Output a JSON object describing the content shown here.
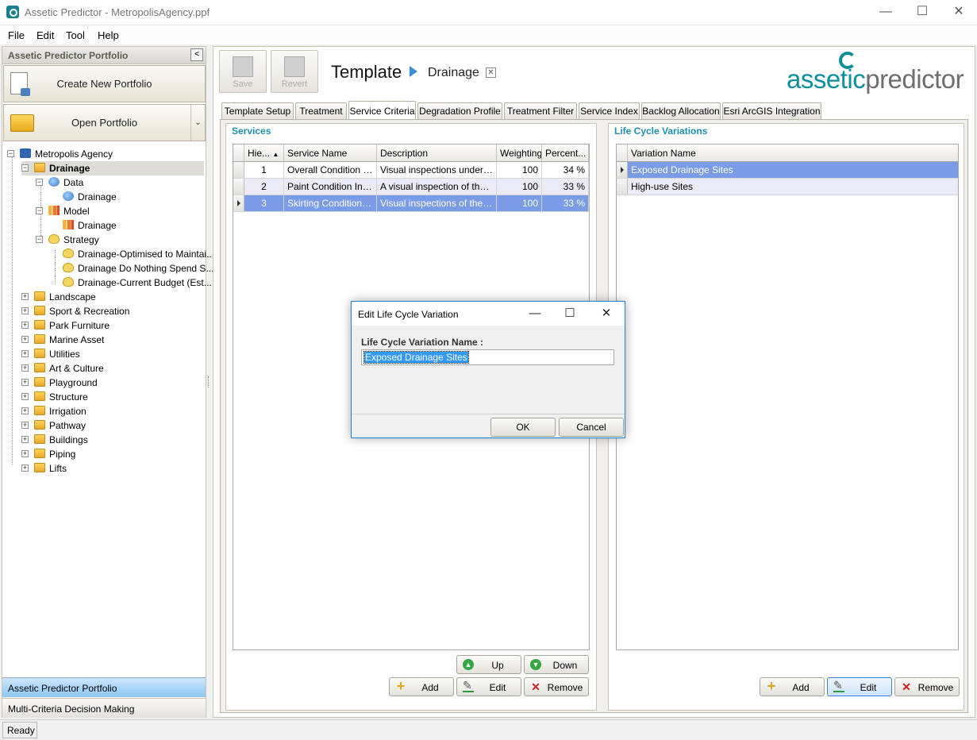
{
  "window": {
    "title": "Assetic Predictor - MetropolisAgency.ppf",
    "minimize": "—",
    "maximize": "☐",
    "close": "✕"
  },
  "menu": [
    "File",
    "Edit",
    "Tool",
    "Help"
  ],
  "left_panel": {
    "header": "Assetic Predictor Portfolio",
    "create_btn": "Create New Portfolio",
    "open_btn": "Open Portfolio",
    "tree": {
      "root": "Metropolis Agency",
      "drainage": "Drainage",
      "data": "Data",
      "data_child": "Drainage",
      "model": "Model",
      "model_child": "Drainage",
      "strategy": "Strategy",
      "strategies": [
        "Drainage-Optimised to Maintai...",
        "Drainage Do Nothing Spend S...",
        "Drainage-Current Budget (Est..."
      ],
      "folders": [
        "Landscape",
        "Sport & Recreation",
        "Park Furniture",
        "Marine Asset",
        "Utilities",
        "Art & Culture",
        "Playground",
        "Structure",
        "Irrigation",
        "Pathway",
        "Buildings",
        "Piping",
        "Lifts"
      ]
    },
    "bottom_tabs": [
      "Assetic Predictor Portfolio",
      "Multi-Criteria Decision Making"
    ]
  },
  "toolbar": {
    "save": "Save",
    "revert": "Revert"
  },
  "template": {
    "title": "Template",
    "subtitle": "Drainage",
    "close": "✕"
  },
  "logo": {
    "part1": "assetic",
    "part2": "predictor"
  },
  "tabs": [
    "Template Setup",
    "Treatment",
    "Service Criteria",
    "Degradation Profile",
    "Treatment Filter",
    "Service Index",
    "Backlog Allocation",
    "Esri ArcGIS Integration"
  ],
  "services": {
    "title": "Services",
    "columns": [
      "Hie...",
      "Service Name",
      "Description",
      "Weighting",
      "Percent..."
    ],
    "rows": [
      [
        "1",
        "Overall Condition In...",
        "Visual inspections undertak...",
        "100",
        "34 %"
      ],
      [
        "2",
        "Paint Condition Index",
        "A visual inspection of the p...",
        "100",
        "33 %"
      ],
      [
        "3",
        "Skirting Condition In...",
        "Visual inspections of the co...",
        "100",
        "33 %"
      ]
    ],
    "buttons": {
      "up": "Up",
      "down": "Down",
      "add": "Add",
      "edit": "Edit",
      "remove": "Remove"
    }
  },
  "lifecycle": {
    "title": "Life Cycle Variations",
    "column": "Variation Name",
    "rows": [
      "Exposed Drainage Sites",
      "High-use Sites"
    ],
    "buttons": {
      "add": "Add",
      "edit": "Edit",
      "remove": "Remove"
    }
  },
  "dialog": {
    "title": "Edit Life Cycle Variation",
    "label": "Life Cycle Variation Name :",
    "value": "Exposed Drainage Sites",
    "ok": "OK",
    "cancel": "Cancel"
  },
  "status": "Ready"
}
